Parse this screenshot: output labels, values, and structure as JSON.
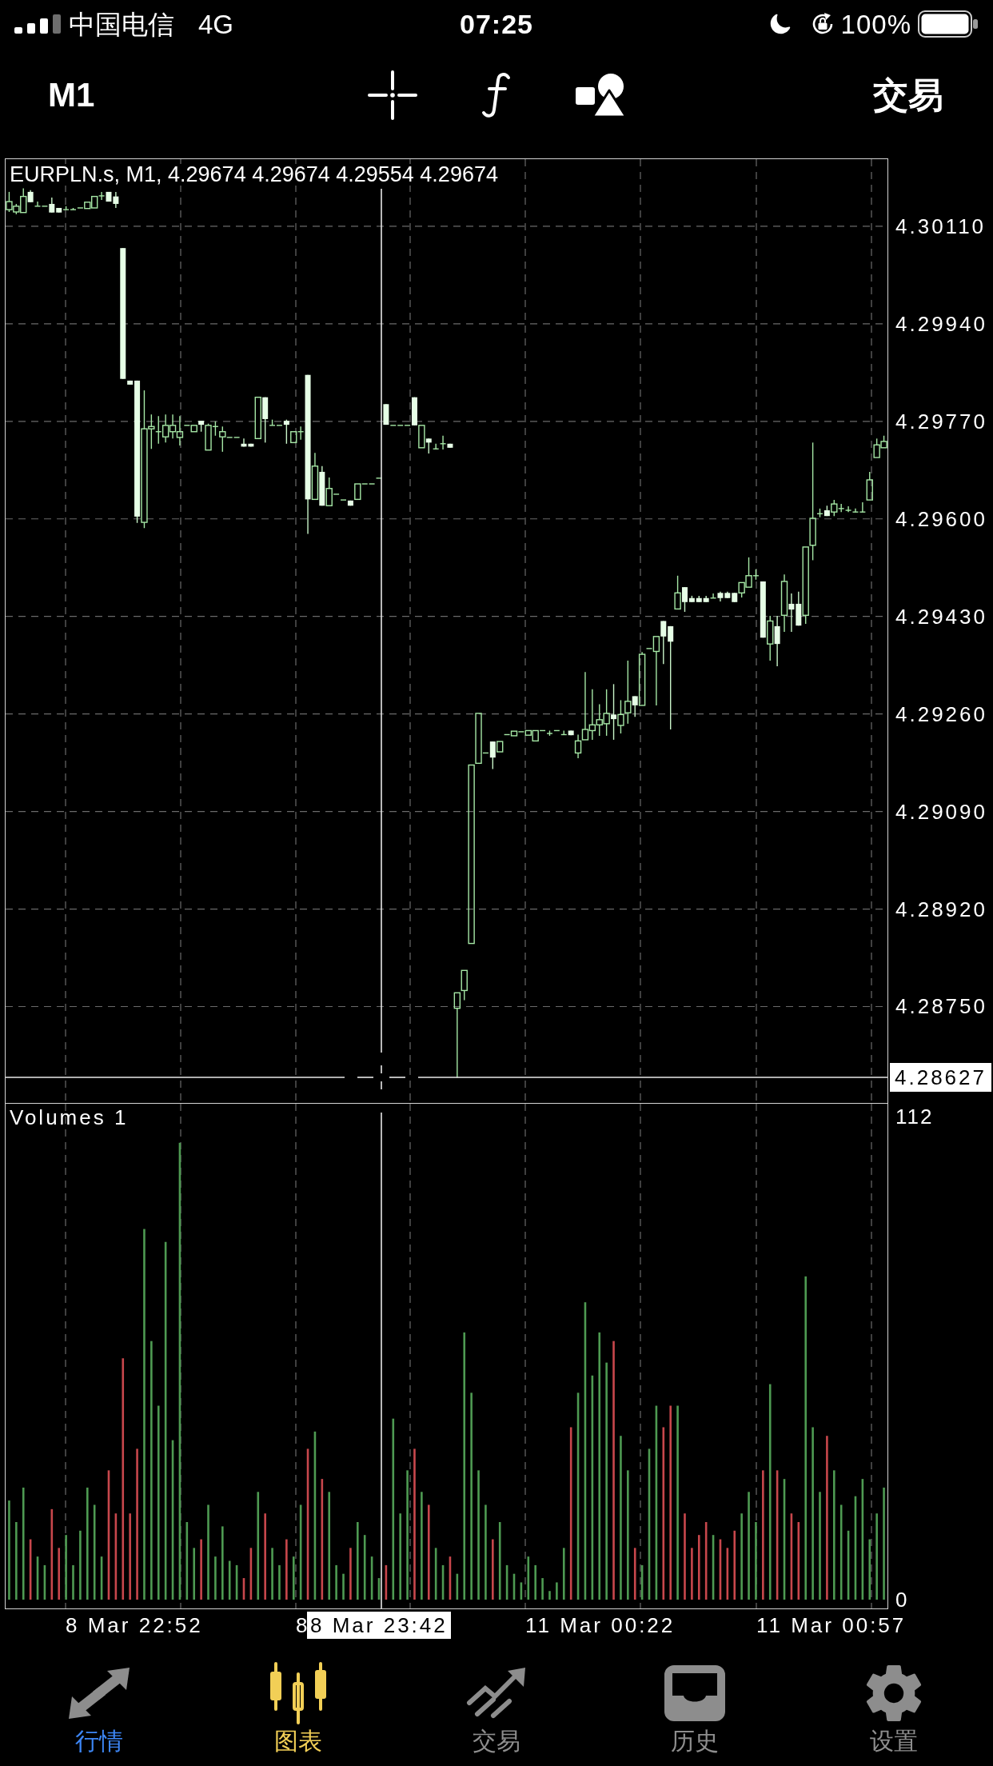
{
  "status_bar": {
    "carrier": "中国电信",
    "network": "4G",
    "time": "07:25",
    "battery_percent": "100%"
  },
  "toolbar": {
    "timeframe": "M1",
    "trade_label": "交易"
  },
  "chart": {
    "price_pane": {
      "chart_data": {
        "type": "candlestick",
        "title": "EURPLN.s, M1, 4.29674 4.29674 4.29554 4.29674",
        "grid": true,
        "categories": [
          null,
          null,
          null,
          null,
          null,
          null,
          null,
          null,
          null,
          null,
          null,
          null,
          null,
          null,
          null,
          null,
          null,
          null,
          null,
          null,
          null,
          null,
          null,
          null,
          null,
          null,
          null,
          null,
          null,
          null,
          null,
          null,
          null,
          null,
          null,
          null,
          null,
          null,
          null,
          null,
          null,
          null,
          null,
          null,
          null,
          null,
          null,
          null,
          null,
          null,
          null,
          null,
          null,
          null,
          null,
          null,
          null,
          null,
          null,
          null,
          null,
          null,
          null,
          null,
          null,
          null,
          null,
          null,
          null,
          null,
          null,
          null,
          null,
          null,
          null,
          null,
          null,
          null,
          null,
          null,
          null,
          null,
          null,
          null,
          null,
          null,
          null,
          null,
          null,
          null,
          null,
          null,
          null,
          null,
          null,
          null,
          null,
          null,
          null,
          null,
          null,
          null,
          null,
          null,
          null,
          null,
          null,
          null,
          null,
          null,
          null,
          null,
          null,
          null,
          null,
          null,
          null,
          null,
          null,
          null,
          null,
          null,
          null,
          null
        ],
        "ohlc": [
          [
            4.30139,
            4.3017,
            4.30135,
            4.30153
          ],
          [
            4.30135,
            4.30149,
            4.30131,
            4.30145
          ],
          [
            4.30134,
            4.30176,
            4.30134,
            4.30162
          ],
          [
            4.3017,
            4.30173,
            4.30152,
            4.30152
          ],
          [
            4.30145,
            4.30153,
            4.30145,
            4.30145
          ],
          [
            4.30145,
            4.30145,
            4.30145,
            4.30145
          ],
          [
            4.30149,
            4.3016,
            4.30134,
            4.30134
          ],
          [
            4.30142,
            4.30142,
            4.30134,
            4.30134
          ],
          [
            4.30139,
            4.30145,
            4.30139,
            4.30139
          ],
          [
            4.30139,
            4.30142,
            4.30139,
            4.30139
          ],
          [
            4.30142,
            4.30142,
            4.30142,
            4.30142
          ],
          [
            4.30141,
            4.30152,
            4.30141,
            4.30152
          ],
          [
            4.30142,
            4.30162,
            4.30142,
            4.30162
          ],
          [
            4.30163,
            4.3017,
            4.30156,
            4.30163
          ],
          [
            4.3017,
            4.3017,
            4.30153,
            4.30153
          ],
          [
            4.30162,
            4.3017,
            4.30142,
            4.30149
          ],
          [
            4.30072,
            4.30072,
            4.29844,
            4.29844
          ],
          [
            4.29841,
            4.29841,
            4.29834,
            4.29834
          ],
          [
            4.29841,
            4.29841,
            4.29593,
            4.29604
          ],
          [
            4.29594,
            4.29824,
            4.29584,
            4.29757
          ],
          [
            4.29757,
            4.29782,
            4.29722,
            4.29761
          ],
          [
            4.29752,
            4.29779,
            4.29731,
            4.29752
          ],
          [
            4.29743,
            4.29782,
            4.29733,
            4.29763
          ],
          [
            4.29752,
            4.29782,
            4.2974,
            4.29763
          ],
          [
            4.29742,
            4.29779,
            4.29728,
            4.29752
          ],
          [
            4.29763,
            4.29763,
            4.29763,
            4.29763
          ],
          [
            4.29752,
            4.29763,
            4.29752,
            4.29763
          ],
          [
            4.29771,
            4.29771,
            4.29752,
            4.29764
          ],
          [
            4.2972,
            4.29766,
            4.2972,
            4.29763
          ],
          [
            4.29761,
            4.2977,
            4.29745,
            4.29761
          ],
          [
            4.29743,
            4.29761,
            4.29717,
            4.29752
          ],
          [
            4.29742,
            4.29742,
            4.29742,
            4.29742
          ],
          [
            4.29742,
            4.29742,
            4.29742,
            4.29742
          ],
          [
            4.29731,
            4.2974,
            4.29726,
            4.29726
          ],
          [
            4.29731,
            4.29731,
            4.29726,
            4.29726
          ],
          [
            4.2974,
            4.29812,
            4.2974,
            4.29812
          ],
          [
            4.29812,
            4.29812,
            4.29733,
            4.29774
          ],
          [
            4.29763,
            4.29773,
            4.29763,
            4.29763
          ],
          [
            4.29763,
            4.29763,
            4.29763,
            4.29763
          ],
          [
            4.29771,
            4.29773,
            4.29731,
            4.29764
          ],
          [
            4.29733,
            4.29752,
            4.29733,
            4.29752
          ],
          [
            4.29752,
            4.29761,
            4.29738,
            4.29752
          ],
          [
            4.29851,
            4.29851,
            4.29574,
            4.29634
          ],
          [
            4.29634,
            4.29715,
            4.29634,
            4.29692
          ],
          [
            4.29682,
            4.29692,
            4.29623,
            4.29623
          ],
          [
            4.29623,
            4.29672,
            4.29623,
            4.29653
          ],
          [
            4.29643,
            4.29643,
            4.29643,
            4.29643
          ],
          [
            4.29633,
            4.29633,
            4.29633,
            4.29633
          ],
          [
            4.29632,
            4.29632,
            4.29623,
            4.29623
          ],
          [
            4.29634,
            4.29661,
            4.29634,
            4.29661
          ],
          [
            4.29661,
            4.29661,
            4.29661,
            4.29661
          ],
          [
            4.29661,
            4.29661,
            4.29661,
            4.29661
          ],
          [
            4.29671,
            4.29671,
            4.29671,
            4.29671
          ],
          [
            4.298,
            4.298,
            4.29764,
            4.29764
          ],
          [
            4.29763,
            4.29763,
            4.29763,
            4.29763
          ],
          [
            4.29763,
            4.29763,
            4.29763,
            4.29763
          ],
          [
            4.29763,
            4.29763,
            4.29763,
            4.29763
          ],
          [
            4.29812,
            4.29812,
            4.29763,
            4.29763
          ],
          [
            4.29724,
            4.29763,
            4.29724,
            4.29763
          ],
          [
            4.2974,
            4.2974,
            4.29714,
            4.29733
          ],
          [
            4.29722,
            4.29731,
            4.29722,
            4.29722
          ],
          [
            4.29731,
            4.29745,
            4.29721,
            4.29731
          ],
          [
            4.29731,
            4.29731,
            4.29724,
            4.29724
          ],
          [
            4.28747,
            4.28774,
            4.28626,
            4.28774
          ],
          [
            4.28778,
            4.28813,
            4.28761,
            4.28813
          ],
          [
            4.2886,
            4.29171,
            4.2886,
            4.29171
          ],
          [
            4.29174,
            4.29261,
            4.29174,
            4.29261
          ],
          [
            4.29192,
            4.29192,
            4.29192,
            4.29192
          ],
          [
            4.29212,
            4.29212,
            4.29164,
            4.29184
          ],
          [
            4.29194,
            4.29212,
            4.29194,
            4.29212
          ],
          [
            4.29224,
            4.29224,
            4.29224,
            4.29224
          ],
          [
            4.29222,
            4.2923,
            4.29222,
            4.2923
          ],
          [
            4.29229,
            4.29229,
            4.29229,
            4.29229
          ],
          [
            4.29223,
            4.29231,
            4.29223,
            4.29231
          ],
          [
            4.29213,
            4.29231,
            4.29213,
            4.29231
          ],
          [
            4.29231,
            4.29231,
            4.29231,
            4.29231
          ],
          [
            4.29226,
            4.29231,
            4.29222,
            4.29226
          ],
          [
            4.29231,
            4.29231,
            4.29231,
            4.29231
          ],
          [
            4.29224,
            4.29231,
            4.29224,
            4.29224
          ],
          [
            4.29231,
            4.29231,
            4.29223,
            4.29223
          ],
          [
            4.29192,
            4.29224,
            4.29183,
            4.29213
          ],
          [
            4.29215,
            4.29333,
            4.29215,
            4.29233
          ],
          [
            4.29231,
            4.29303,
            4.29215,
            4.29241
          ],
          [
            4.29241,
            4.29277,
            4.29222,
            4.2925
          ],
          [
            4.29243,
            4.29303,
            4.29222,
            4.29261
          ],
          [
            4.29259,
            4.29312,
            4.29215,
            4.29251
          ],
          [
            4.2924,
            4.29284,
            4.29226,
            4.29259
          ],
          [
            4.29262,
            4.29353,
            4.29243,
            4.29282
          ],
          [
            4.29291,
            4.29291,
            4.29255,
            4.29275
          ],
          [
            4.29275,
            4.29368,
            4.29275,
            4.29364
          ],
          [
            4.29374,
            4.29374,
            4.29374,
            4.29374
          ],
          [
            4.29369,
            4.29395,
            4.29275,
            4.29395
          ],
          [
            4.29422,
            4.29422,
            4.29347,
            4.29395
          ],
          [
            4.29413,
            4.29413,
            4.29233,
            4.29386
          ],
          [
            4.29443,
            4.29501,
            4.29443,
            4.29471
          ],
          [
            4.29481,
            4.29481,
            4.29438,
            4.29455
          ],
          [
            4.29462,
            4.29466,
            4.29455,
            4.29455
          ],
          [
            4.29462,
            4.29466,
            4.29455,
            4.29455
          ],
          [
            4.29462,
            4.29466,
            4.29455,
            4.29455
          ],
          [
            4.29462,
            4.2947,
            4.29462,
            4.29462
          ],
          [
            4.29471,
            4.29473,
            4.29456,
            4.29462
          ],
          [
            4.29471,
            4.29473,
            4.29462,
            4.29462
          ],
          [
            4.29471,
            4.29471,
            4.29455,
            4.29455
          ],
          [
            4.29471,
            4.29489,
            4.29463,
            4.29489
          ],
          [
            4.29481,
            4.29533,
            4.29481,
            4.29501
          ],
          [
            4.29501,
            4.29512,
            4.29494,
            4.29501
          ],
          [
            4.29491,
            4.29491,
            4.29393,
            4.29393
          ],
          [
            4.29382,
            4.29431,
            4.29353,
            4.29422
          ],
          [
            4.29413,
            4.29431,
            4.29343,
            4.29382
          ],
          [
            4.29432,
            4.29503,
            4.29403,
            4.29491
          ],
          [
            4.29452,
            4.2947,
            4.29403,
            4.29442
          ],
          [
            4.29452,
            4.29473,
            4.29414,
            4.29414
          ],
          [
            4.29432,
            4.29551,
            4.29417,
            4.29551
          ],
          [
            4.29554,
            4.29733,
            4.29528,
            4.29601
          ],
          [
            4.29609,
            4.29618,
            4.29603,
            4.29609
          ],
          [
            4.29615,
            4.29623,
            4.29605,
            4.29605
          ],
          [
            4.29612,
            4.29633,
            4.29605,
            4.29626
          ],
          [
            4.29618,
            4.29626,
            4.29612,
            4.29618
          ],
          [
            4.29615,
            4.29622,
            4.29612,
            4.29615
          ],
          [
            4.29612,
            4.29618,
            4.29612,
            4.29612
          ],
          [
            4.29612,
            4.29629,
            4.29612,
            4.29612
          ],
          [
            4.29633,
            4.29682,
            4.29633,
            4.29668
          ],
          [
            4.29707,
            4.2974,
            4.29707,
            4.29729
          ],
          [
            4.29724,
            4.29745,
            4.29724,
            4.29735
          ]
        ],
        "ylim": [
          4.28582,
          4.30227
        ],
        "yticks": [
          {
            "value": 4.3011,
            "label": "4.30110"
          },
          {
            "value": 4.2994,
            "label": "4.29940"
          },
          {
            "value": 4.2977,
            "label": "4.29770"
          },
          {
            "value": 4.296,
            "label": "4.29600"
          },
          {
            "value": 4.2943,
            "label": "4.29430"
          },
          {
            "value": 4.2926,
            "label": "4.29260"
          },
          {
            "value": 4.2909,
            "label": "4.29090"
          },
          {
            "value": 4.2892,
            "label": "4.28920"
          },
          {
            "value": 4.2875,
            "label": "4.28750"
          }
        ]
      },
      "crosshair_price": "4.28627"
    },
    "volume_pane": {
      "chart_data": {
        "type": "bar",
        "title": "Volumes 1",
        "grid": true,
        "stacked": true,
        "categories": [
          null,
          null,
          null,
          null,
          null,
          null,
          null,
          null,
          null,
          null,
          null,
          null,
          null,
          null,
          null,
          null,
          null,
          null,
          null,
          null,
          null,
          null,
          null,
          null,
          null,
          null,
          null,
          null,
          null,
          null,
          null,
          null,
          null,
          null,
          null,
          null,
          null,
          null,
          null,
          null,
          null,
          null,
          null,
          null,
          null,
          null,
          null,
          null,
          null,
          null,
          null,
          null,
          null,
          null,
          null,
          null,
          null,
          null,
          null,
          null,
          null,
          null,
          null,
          null,
          null,
          null,
          null,
          null,
          null,
          null,
          null,
          null,
          null,
          null,
          null,
          null,
          null,
          null,
          null,
          null,
          null,
          null,
          null,
          null,
          null,
          null,
          null,
          null,
          null,
          null,
          null,
          null,
          null,
          null,
          null,
          null,
          null,
          null,
          null,
          null,
          null,
          null,
          null,
          null,
          null,
          null,
          null,
          null,
          null,
          null,
          null,
          null,
          null,
          null,
          null,
          null,
          null,
          null,
          null,
          null,
          null,
          null,
          null,
          null
        ],
        "series": [
          {
            "color": "#4e9a52",
            "values": [
              23,
              18,
              26,
              null,
              10,
              8,
              null,
              null,
              15,
              8,
              16,
              26,
              22,
              10,
              null,
              null,
              null,
              null,
              null,
              86,
              60,
              45,
              83,
              37,
              106,
              18,
              12,
              null,
              22,
              10,
              17,
              9,
              8,
              null,
              null,
              25,
              null,
              12,
              8,
              null,
              10,
              22,
              null,
              39,
              null,
              25,
              8,
              6,
              null,
              18,
              15,
              10,
              5,
              null,
              42,
              20,
              30,
              null,
              25,
              null,
              12,
              8,
              null,
              6,
              62,
              48,
              30,
              22,
              null,
              18,
              8,
              6,
              4,
              10,
              8,
              5,
              2,
              4,
              12,
              null,
              48,
              69,
              52,
              62,
              55,
              null,
              38,
              30,
              null,
              8,
              35,
              45,
              null,
              null,
              45,
              null,
              null,
              null,
              null,
              15,
              null,
              null,
              null,
              20,
              25,
              18,
              null,
              50,
              null,
              28,
              null,
              null,
              75,
              40,
              25,
              null,
              30,
              22,
              16,
              24,
              28,
              14,
              20,
              26
            ]
          },
          {
            "color": "#c8474c",
            "values": [
              null,
              null,
              null,
              14,
              null,
              null,
              21,
              12,
              null,
              null,
              null,
              null,
              null,
              null,
              30,
              20,
              56,
              20,
              35,
              null,
              null,
              null,
              null,
              null,
              null,
              null,
              null,
              14,
              null,
              null,
              null,
              null,
              null,
              5,
              12,
              null,
              20,
              null,
              null,
              14,
              null,
              null,
              35,
              null,
              28,
              null,
              null,
              null,
              12,
              null,
              null,
              null,
              null,
              8,
              null,
              null,
              null,
              35,
              null,
              22,
              null,
              null,
              10,
              null,
              null,
              null,
              null,
              null,
              14,
              null,
              null,
              null,
              null,
              null,
              null,
              null,
              null,
              null,
              null,
              40,
              null,
              null,
              null,
              null,
              null,
              60,
              null,
              null,
              12,
              null,
              null,
              null,
              40,
              45,
              null,
              20,
              12,
              15,
              18,
              null,
              14,
              12,
              16,
              null,
              null,
              null,
              30,
              null,
              30,
              null,
              20,
              18,
              null,
              null,
              null,
              38,
              null,
              null,
              null,
              null,
              null,
              null,
              null,
              null
            ]
          }
        ],
        "ylim": [
          -2.04,
          115.06
        ],
        "yticks": [
          {
            "value": 112,
            "label": "112"
          },
          {
            "value": 0,
            "label": "0"
          }
        ]
      }
    },
    "time_axis": [
      "8 Mar 22:52",
      "8",
      "11 Mar 00:22",
      "11 Mar 00:57"
    ],
    "crosshair_time": "8 Mar 23:42"
  },
  "tab_bar": [
    {
      "label": "行情",
      "selected": false,
      "color": "#3d86f5"
    },
    {
      "label": "图表",
      "selected": true,
      "color": "#f2cf56"
    },
    {
      "label": "交易",
      "selected": false,
      "color": "#8e8e8e"
    },
    {
      "label": "历史",
      "selected": false,
      "color": "#8e8e8e"
    },
    {
      "label": "设置",
      "selected": false,
      "color": "#8e8e8e"
    }
  ]
}
